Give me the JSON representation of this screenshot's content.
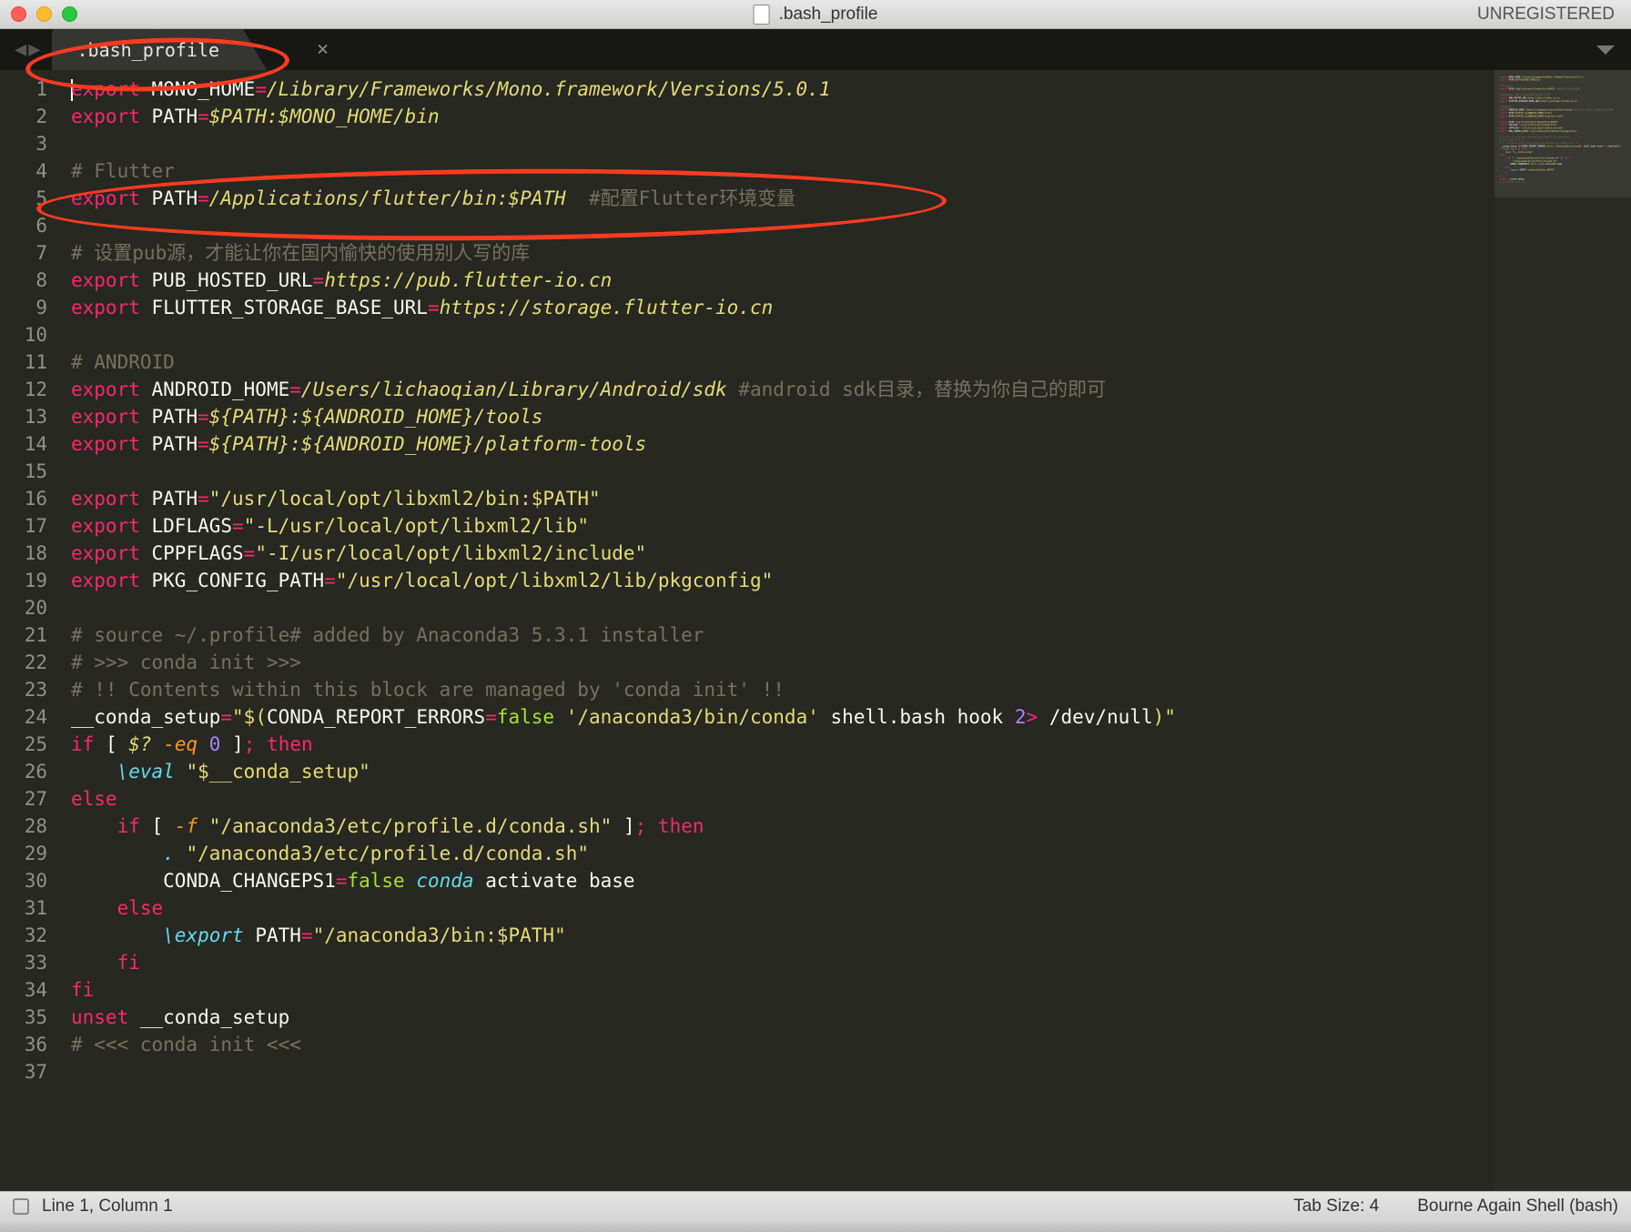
{
  "window": {
    "title": ".bash_profile",
    "unregistered": "UNREGISTERED"
  },
  "tab": {
    "name": ".bash_profile"
  },
  "lines": [
    {
      "n": 1,
      "tokens": [
        [
          "kw",
          "export"
        ],
        [
          "sp",
          " "
        ],
        [
          "var",
          "MONO_HOME"
        ],
        [
          "op",
          "="
        ],
        [
          "val",
          "/Library/Frameworks/Mono.framework/Versions/5.0.1"
        ]
      ]
    },
    {
      "n": 2,
      "tokens": [
        [
          "kw",
          "export"
        ],
        [
          "sp",
          " "
        ],
        [
          "var",
          "PATH"
        ],
        [
          "op",
          "="
        ],
        [
          "val",
          "$PATH:$MONO_HOME/bin"
        ]
      ]
    },
    {
      "n": 3,
      "tokens": []
    },
    {
      "n": 4,
      "tokens": [
        [
          "cmt",
          "# Flutter"
        ]
      ]
    },
    {
      "n": 5,
      "tokens": [
        [
          "kw",
          "export"
        ],
        [
          "sp",
          " "
        ],
        [
          "var",
          "PATH"
        ],
        [
          "op",
          "="
        ],
        [
          "val",
          "/Applications/flutter/bin:$PATH"
        ],
        [
          "sp",
          "  "
        ],
        [
          "cmt",
          "#配置Flutter环境变量"
        ]
      ]
    },
    {
      "n": 6,
      "tokens": []
    },
    {
      "n": 7,
      "tokens": [
        [
          "cmt",
          "# 设置pub源，才能让你在国内愉快的使用别人写的库"
        ]
      ]
    },
    {
      "n": 8,
      "tokens": [
        [
          "kw",
          "export"
        ],
        [
          "sp",
          " "
        ],
        [
          "var",
          "PUB_HOSTED_URL"
        ],
        [
          "op",
          "="
        ],
        [
          "val",
          "https://pub.flutter-io.cn"
        ]
      ]
    },
    {
      "n": 9,
      "tokens": [
        [
          "kw",
          "export"
        ],
        [
          "sp",
          " "
        ],
        [
          "var",
          "FLUTTER_STORAGE_BASE_URL"
        ],
        [
          "op",
          "="
        ],
        [
          "val",
          "https://storage.flutter-io.cn"
        ]
      ]
    },
    {
      "n": 10,
      "tokens": []
    },
    {
      "n": 11,
      "tokens": [
        [
          "cmt",
          "# ANDROID"
        ]
      ]
    },
    {
      "n": 12,
      "tokens": [
        [
          "kw",
          "export"
        ],
        [
          "sp",
          " "
        ],
        [
          "var",
          "ANDROID_HOME"
        ],
        [
          "op",
          "="
        ],
        [
          "val",
          "/Users/lichaoqian/Library/Android/sdk"
        ],
        [
          "sp",
          " "
        ],
        [
          "cmt",
          "#android sdk目录，替换为你自己的即可"
        ]
      ]
    },
    {
      "n": 13,
      "tokens": [
        [
          "kw",
          "export"
        ],
        [
          "sp",
          " "
        ],
        [
          "var",
          "PATH"
        ],
        [
          "op",
          "="
        ],
        [
          "val",
          "${PATH}:${ANDROID_HOME}/tools"
        ]
      ]
    },
    {
      "n": 14,
      "tokens": [
        [
          "kw",
          "export"
        ],
        [
          "sp",
          " "
        ],
        [
          "var",
          "PATH"
        ],
        [
          "op",
          "="
        ],
        [
          "val",
          "${PATH}:${ANDROID_HOME}/platform-tools"
        ]
      ]
    },
    {
      "n": 15,
      "tokens": []
    },
    {
      "n": 16,
      "tokens": [
        [
          "kw",
          "export"
        ],
        [
          "sp",
          " "
        ],
        [
          "var",
          "PATH"
        ],
        [
          "op",
          "="
        ],
        [
          "str",
          "\"/usr/local/opt/libxml2/bin:$PATH\""
        ]
      ]
    },
    {
      "n": 17,
      "tokens": [
        [
          "kw",
          "export"
        ],
        [
          "sp",
          " "
        ],
        [
          "var",
          "LDFLAGS"
        ],
        [
          "op",
          "="
        ],
        [
          "str",
          "\"-L/usr/local/opt/libxml2/lib\""
        ]
      ]
    },
    {
      "n": 18,
      "tokens": [
        [
          "kw",
          "export"
        ],
        [
          "sp",
          " "
        ],
        [
          "var",
          "CPPFLAGS"
        ],
        [
          "op",
          "="
        ],
        [
          "str",
          "\"-I/usr/local/opt/libxml2/include\""
        ]
      ]
    },
    {
      "n": 19,
      "tokens": [
        [
          "kw",
          "export"
        ],
        [
          "sp",
          " "
        ],
        [
          "var",
          "PKG_CONFIG_PATH"
        ],
        [
          "op",
          "="
        ],
        [
          "str",
          "\"/usr/local/opt/libxml2/lib/pkgconfig\""
        ]
      ]
    },
    {
      "n": 20,
      "tokens": []
    },
    {
      "n": 21,
      "tokens": [
        [
          "cmt",
          "# source ~/.profile# added by Anaconda3 5.3.1 installer"
        ]
      ]
    },
    {
      "n": 22,
      "tokens": [
        [
          "cmt",
          "# >>> conda init >>>"
        ]
      ]
    },
    {
      "n": 23,
      "tokens": [
        [
          "cmt",
          "# !! Contents within this block are managed by 'conda init' !!"
        ]
      ]
    },
    {
      "n": 24,
      "tokens": [
        [
          "var",
          "__conda_setup"
        ],
        [
          "op",
          "="
        ],
        [
          "str",
          "\"$("
        ],
        [
          "var",
          "CONDA_REPORT_ERRORS"
        ],
        [
          "op",
          "="
        ],
        [
          "builtin",
          "false"
        ],
        [
          "sp",
          " "
        ],
        [
          "str",
          "'/anaconda3/bin/conda'"
        ],
        [
          "sp",
          " "
        ],
        [
          "var",
          "shell.bash hook "
        ],
        [
          "num",
          "2"
        ],
        [
          "op",
          ">"
        ],
        [
          "sp",
          " "
        ],
        [
          "var",
          "/dev/null"
        ],
        [
          "str",
          ")\""
        ]
      ]
    },
    {
      "n": 25,
      "tokens": [
        [
          "kw",
          "if"
        ],
        [
          "sp",
          " "
        ],
        [
          "var",
          "[ "
        ],
        [
          "val",
          "$?"
        ],
        [
          "sp",
          " "
        ],
        [
          "arg",
          "-eq"
        ],
        [
          "sp",
          " "
        ],
        [
          "num",
          "0"
        ],
        [
          "sp",
          " "
        ],
        [
          "var",
          "]"
        ],
        [
          "op",
          ";"
        ],
        [
          "sp",
          " "
        ],
        [
          "kw",
          "then"
        ]
      ]
    },
    {
      "n": 26,
      "tokens": [
        [
          "sp",
          "    "
        ],
        [
          "fn",
          "\\eval"
        ],
        [
          "sp",
          " "
        ],
        [
          "str",
          "\"$__conda_setup\""
        ]
      ]
    },
    {
      "n": 27,
      "tokens": [
        [
          "kw",
          "else"
        ]
      ]
    },
    {
      "n": 28,
      "tokens": [
        [
          "sp",
          "    "
        ],
        [
          "kw",
          "if"
        ],
        [
          "sp",
          " "
        ],
        [
          "var",
          "[ "
        ],
        [
          "arg",
          "-f"
        ],
        [
          "sp",
          " "
        ],
        [
          "str",
          "\"/anaconda3/etc/profile.d/conda.sh\""
        ],
        [
          "sp",
          " "
        ],
        [
          "var",
          "]"
        ],
        [
          "op",
          ";"
        ],
        [
          "sp",
          " "
        ],
        [
          "kw",
          "then"
        ]
      ]
    },
    {
      "n": 29,
      "tokens": [
        [
          "sp",
          "        "
        ],
        [
          "fn",
          "."
        ],
        [
          "sp",
          " "
        ],
        [
          "str",
          "\"/anaconda3/etc/profile.d/conda.sh\""
        ]
      ]
    },
    {
      "n": 30,
      "tokens": [
        [
          "sp",
          "        "
        ],
        [
          "var",
          "CONDA_CHANGEPS1"
        ],
        [
          "op",
          "="
        ],
        [
          "builtin",
          "false"
        ],
        [
          "sp",
          " "
        ],
        [
          "fn",
          "conda"
        ],
        [
          "sp",
          " "
        ],
        [
          "var",
          "activate base"
        ]
      ]
    },
    {
      "n": 31,
      "tokens": [
        [
          "sp",
          "    "
        ],
        [
          "kw",
          "else"
        ]
      ]
    },
    {
      "n": 32,
      "tokens": [
        [
          "sp",
          "        "
        ],
        [
          "fn",
          "\\export"
        ],
        [
          "sp",
          " "
        ],
        [
          "var",
          "PATH"
        ],
        [
          "op",
          "="
        ],
        [
          "str",
          "\"/anaconda3/bin:$PATH\""
        ]
      ]
    },
    {
      "n": 33,
      "tokens": [
        [
          "sp",
          "    "
        ],
        [
          "kw",
          "fi"
        ]
      ]
    },
    {
      "n": 34,
      "tokens": [
        [
          "kw",
          "fi"
        ]
      ]
    },
    {
      "n": 35,
      "tokens": [
        [
          "kw",
          "unset"
        ],
        [
          "sp",
          " "
        ],
        [
          "var",
          "__conda_setup"
        ]
      ]
    },
    {
      "n": 36,
      "tokens": [
        [
          "cmt",
          "# <<< conda init <<<"
        ]
      ]
    },
    {
      "n": 37,
      "tokens": []
    }
  ],
  "statusbar": {
    "position": "Line 1, Column 1",
    "tabsize": "Tab Size: 4",
    "syntax": "Bourne Again Shell (bash)"
  }
}
